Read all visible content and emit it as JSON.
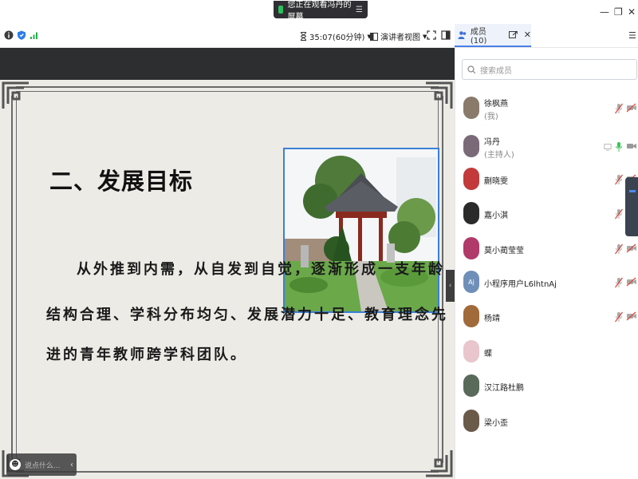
{
  "titlebar": {
    "share_notice": "您正在观看冯丹的屏幕",
    "menu_glyph": "☰",
    "minimize": "—",
    "restore": "❐",
    "close": "✕"
  },
  "toolbar": {
    "timer": "35:07(60分钟)",
    "view_mode": "演讲者视图"
  },
  "panel": {
    "tab_label": "成员(10)",
    "close": "✕",
    "menu": "☰",
    "search_placeholder": "搜索成员"
  },
  "slide": {
    "title": "二、发展目标",
    "body_lines": [
      "从外推到内需，从自发到自觉，逐渐形成一支年龄",
      "结构合理、学科分布均匀、发展潜力十足、教育理念先",
      "进的青年教师跨学科团队。"
    ]
  },
  "chat": {
    "placeholder": "说点什么..."
  },
  "members": [
    {
      "name": "徐枫燕",
      "role": "(我)",
      "avatar_color": "#8a7a6a",
      "mic": "off",
      "cam": "off"
    },
    {
      "name": "冯丹",
      "role": "(主持人)",
      "avatar_color": "#7a6a78",
      "mic": "on",
      "cam": "on"
    },
    {
      "name": "蒯晓雯",
      "role": "",
      "avatar_color": "#c23a3a",
      "mic": "off",
      "cam": "off"
    },
    {
      "name": "嘉小淇",
      "role": "",
      "avatar_color": "#2a2a2a",
      "mic": "off",
      "cam": "off"
    },
    {
      "name": "莫小蔺莹莹",
      "role": "",
      "avatar_color": "#b03a6a",
      "mic": "off",
      "cam": "off"
    },
    {
      "name": "小程序用户L6lhtnAj",
      "role": "",
      "avatar_color": "#6f8fb8",
      "avatar_text": "Aj",
      "mic": "off",
      "cam": "off"
    },
    {
      "name": "杨靖",
      "role": "",
      "avatar_color": "#a06a3a",
      "mic": "off",
      "cam": "off"
    },
    {
      "name": "蝶",
      "role": "",
      "avatar_color": "#e8c6cc",
      "mic": "none",
      "cam": "none"
    },
    {
      "name": "汉江路杜鹏",
      "role": "",
      "avatar_color": "#5a6a5a",
      "mic": "none",
      "cam": "none"
    },
    {
      "name": "梁小歪",
      "role": "",
      "avatar_color": "#6a5a4a",
      "mic": "none",
      "cam": "none"
    }
  ]
}
